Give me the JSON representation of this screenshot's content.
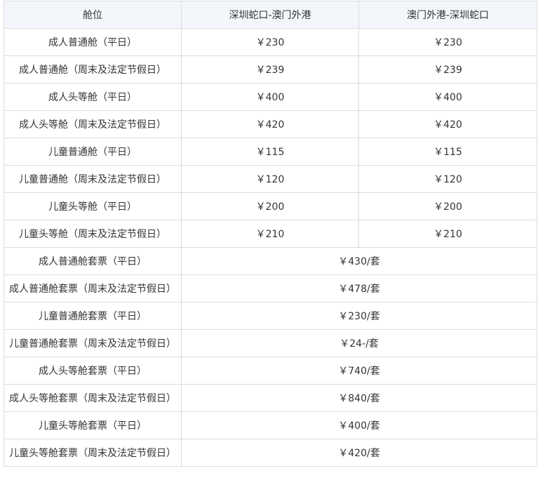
{
  "table": {
    "headers": [
      "舱位",
      "深圳蛇口-澳门外港",
      "澳门外港-深圳蛇口"
    ],
    "single_rows": [
      {
        "type": "成人普通舱（平日）",
        "to_macau": "￥230",
        "to_shenzhen": "￥230"
      },
      {
        "type": "成人普通舱（周末及法定节假日）",
        "to_macau": "￥239",
        "to_shenzhen": "￥239"
      },
      {
        "type": "成人头等舱（平日）",
        "to_macau": "￥400",
        "to_shenzhen": "￥400"
      },
      {
        "type": "成人头等舱（周末及法定节假日）",
        "to_macau": "￥420",
        "to_shenzhen": "￥420"
      },
      {
        "type": "儿童普通舱（平日）",
        "to_macau": "￥115",
        "to_shenzhen": "￥115"
      },
      {
        "type": "儿童普通舱（周末及法定节假日）",
        "to_macau": "￥120",
        "to_shenzhen": "￥120"
      },
      {
        "type": "儿童头等舱（平日）",
        "to_macau": "￥200",
        "to_shenzhen": "￥200"
      },
      {
        "type": "儿童头等舱（周末及法定节假日）",
        "to_macau": "￥210",
        "to_shenzhen": "￥210"
      }
    ],
    "package_rows": [
      {
        "type": "成人普通舱套票（平日）",
        "price": "￥430/套"
      },
      {
        "type": "成人普通舱套票（周末及法定节假日）",
        "price": "￥478/套"
      },
      {
        "type": "儿童普通舱套票（平日）",
        "price": "￥230/套"
      },
      {
        "type": "儿童普通舱套票（周末及法定节假日）",
        "price": "￥24-/套"
      },
      {
        "type": "成人头等舱套票（平日）",
        "price": "￥740/套"
      },
      {
        "type": "成人头等舱套票（周末及法定节假日）",
        "price": "￥840/套"
      },
      {
        "type": "儿童头等舱套票（平日）",
        "price": "￥400/套"
      },
      {
        "type": "儿童头等舱套票（周末及法定节假日）",
        "price": "￥420/套"
      }
    ]
  }
}
